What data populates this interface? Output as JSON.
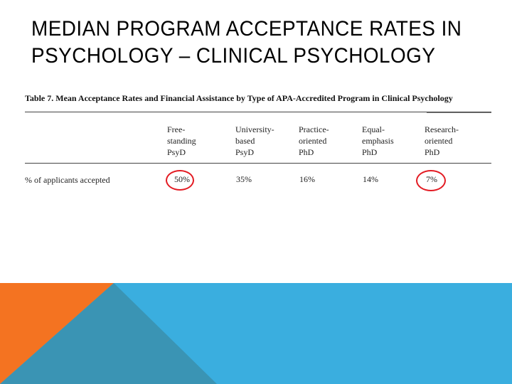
{
  "slide": {
    "title_line1": "MEDIAN PROGRAM ACCEPTANCE RATES IN",
    "title_line2": "PSYCHOLOGY – CLINICAL PSYCHOLOGY"
  },
  "table": {
    "caption": "Table 7.  Mean Acceptance Rates and Financial Assistance by Type of APA-Accredited Program in Clinical Psychology",
    "columns": [
      {
        "line1": "Free-",
        "line2": "standing",
        "line3": "PsyD"
      },
      {
        "line1": "University-",
        "line2": "based",
        "line3": "PsyD"
      },
      {
        "line1": "Practice-",
        "line2": "oriented",
        "line3": "PhD"
      },
      {
        "line1": "Equal-",
        "line2": "emphasis",
        "line3": "PhD"
      },
      {
        "line1": "Research-",
        "line2": "oriented",
        "line3": "PhD"
      }
    ],
    "rows": [
      {
        "label": "% of applicants accepted",
        "values": [
          "50%",
          "35%",
          "16%",
          "14%",
          "7%"
        ]
      }
    ]
  },
  "colors": {
    "highlight_circle": "#e31b23",
    "band_blue": "#3aaedf",
    "band_orange": "#f47321",
    "band_teal": "#3a94b4"
  }
}
